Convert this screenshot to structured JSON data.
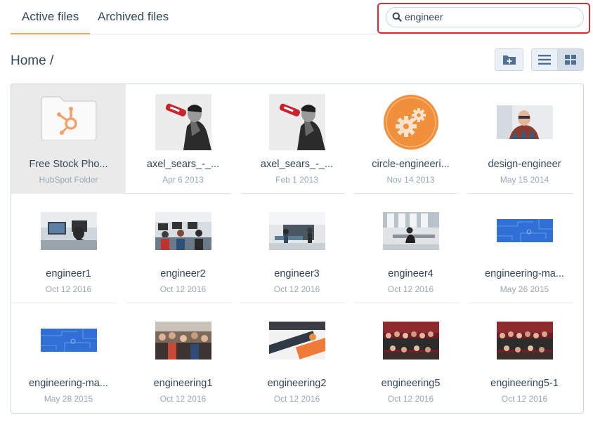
{
  "tabs": [
    {
      "label": "Active files",
      "active": true
    },
    {
      "label": "Archived files",
      "active": false
    }
  ],
  "search": {
    "value": "engineer",
    "placeholder": ""
  },
  "breadcrumb": "Home /",
  "toolbar": {
    "new_folder_icon": "folder-plus-icon",
    "list_view_icon": "list-view-icon",
    "grid_view_icon": "grid-view-icon",
    "active_view": "grid"
  },
  "colors": {
    "accent": "#f2a26b",
    "highlight_border": "#e8262b",
    "text": "#33475b",
    "subtext": "#99a6b4"
  },
  "files": [
    {
      "name": "Free Stock Pho...",
      "sub": "HubSpot Folder",
      "kind": "folder",
      "icon": "hubspot-folder-icon"
    },
    {
      "name": "axel_sears_-_...",
      "sub": "Apr 6 2013",
      "kind": "photo-bw"
    },
    {
      "name": "axel_sears_-_...",
      "sub": "Feb 1 2013",
      "kind": "photo-bw"
    },
    {
      "name": "circle-engineeri...",
      "sub": "Nov 14 2013",
      "kind": "gears-circle"
    },
    {
      "name": "design-engineer",
      "sub": "May 15 2014",
      "kind": "photo-portrait"
    },
    {
      "name": "engineer1",
      "sub": "Oct 12 2016",
      "kind": "photo-office"
    },
    {
      "name": "engineer2",
      "sub": "Oct 12 2016",
      "kind": "photo-office"
    },
    {
      "name": "engineer3",
      "sub": "Oct 12 2016",
      "kind": "photo-office-light"
    },
    {
      "name": "engineer4",
      "sub": "Oct 12 2016",
      "kind": "photo-office-light"
    },
    {
      "name": "engineering-ma...",
      "sub": "May 26 2015",
      "kind": "blueprint"
    },
    {
      "name": "engineering-ma...",
      "sub": "May 28 2015",
      "kind": "blueprint"
    },
    {
      "name": "engineering1",
      "sub": "Oct 12 2016",
      "kind": "photo-crowd"
    },
    {
      "name": "engineering2",
      "sub": "Oct 12 2016",
      "kind": "photo-banner"
    },
    {
      "name": "engineering5",
      "sub": "Oct 12 2016",
      "kind": "photo-group"
    },
    {
      "name": "engineering5-1",
      "sub": "Oct 12 2016",
      "kind": "photo-group"
    }
  ]
}
